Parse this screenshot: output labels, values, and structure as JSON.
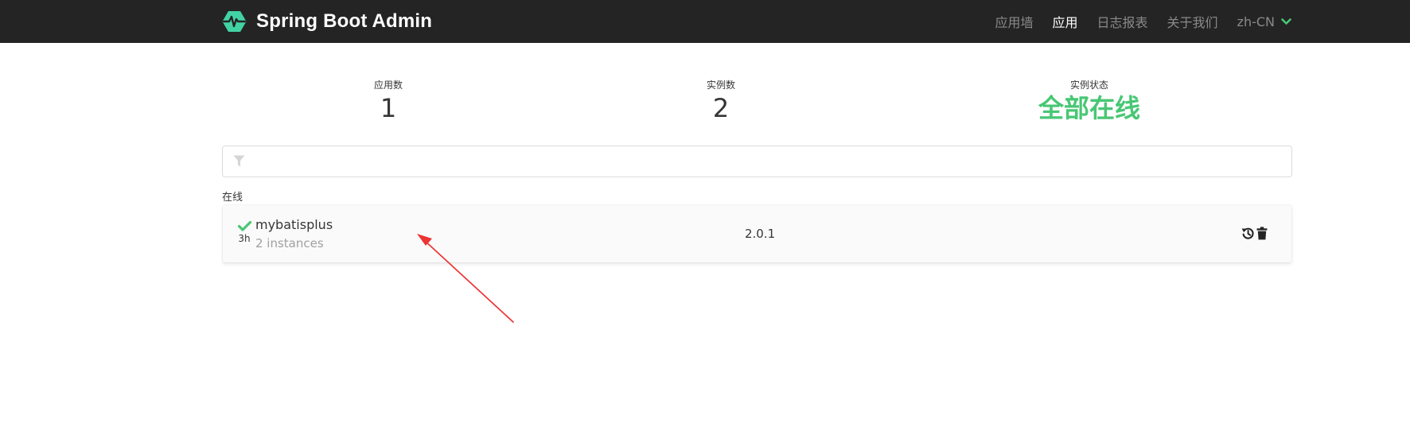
{
  "navbar": {
    "brand_title": "Spring Boot Admin",
    "brand_icon": "heartbeat-hexagon-icon",
    "menu": [
      {
        "label": "应用墙",
        "active": false
      },
      {
        "label": "应用",
        "active": true
      },
      {
        "label": "日志报表",
        "active": false
      },
      {
        "label": "关于我们",
        "active": false
      }
    ],
    "language": "zh-CN"
  },
  "stats": {
    "apps_heading": "应用数",
    "apps_value": "1",
    "instances_heading": "实例数",
    "instances_value": "2",
    "status_heading": "实例状态",
    "status_value": "全部在线"
  },
  "filter": {
    "placeholder": "",
    "value": ""
  },
  "groups": [
    {
      "label": "在线",
      "applications": [
        {
          "name": "mybatisplus",
          "instances": "2 instances",
          "uptime": "3h",
          "version": "2.0.1",
          "status_icon": "check-icon"
        }
      ]
    }
  ],
  "colors": {
    "navbar_bg": "#242424",
    "accent_green": "#48c774",
    "annotation_arrow": "#ee3333"
  }
}
